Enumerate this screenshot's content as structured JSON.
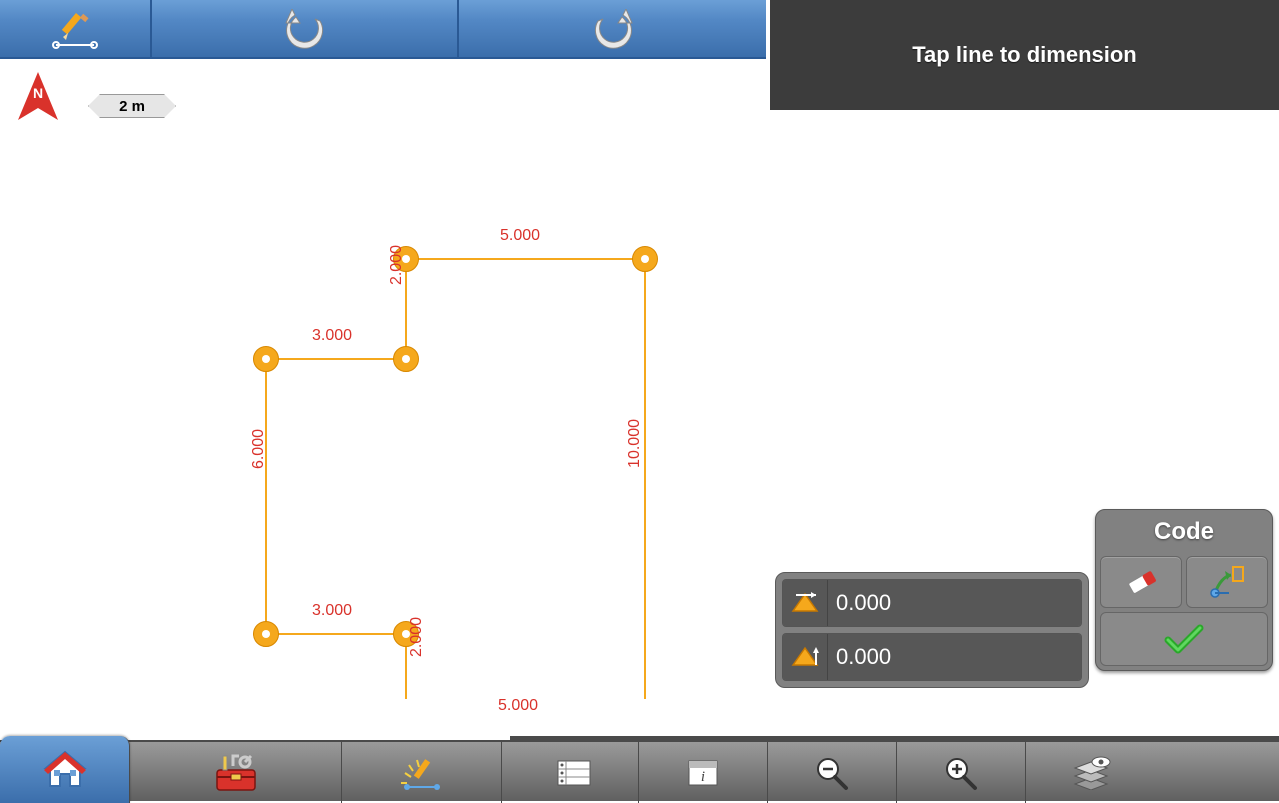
{
  "header": {
    "instruction": "Tap line to dimension"
  },
  "scale": {
    "label": "2 m"
  },
  "compass": {
    "direction": "N"
  },
  "shape": {
    "dimensions": {
      "top": "5.000",
      "right": "10.000",
      "left_upper_vert": "2.000",
      "mid_horiz_upper": "3.000",
      "left_vert": "6.000",
      "mid_horiz_lower": "3.000",
      "lower_vert": "2.000",
      "bottom": "5.000"
    }
  },
  "values": {
    "horizontal": "0.000",
    "vertical": "0.000"
  },
  "code_panel": {
    "title": "Code"
  }
}
